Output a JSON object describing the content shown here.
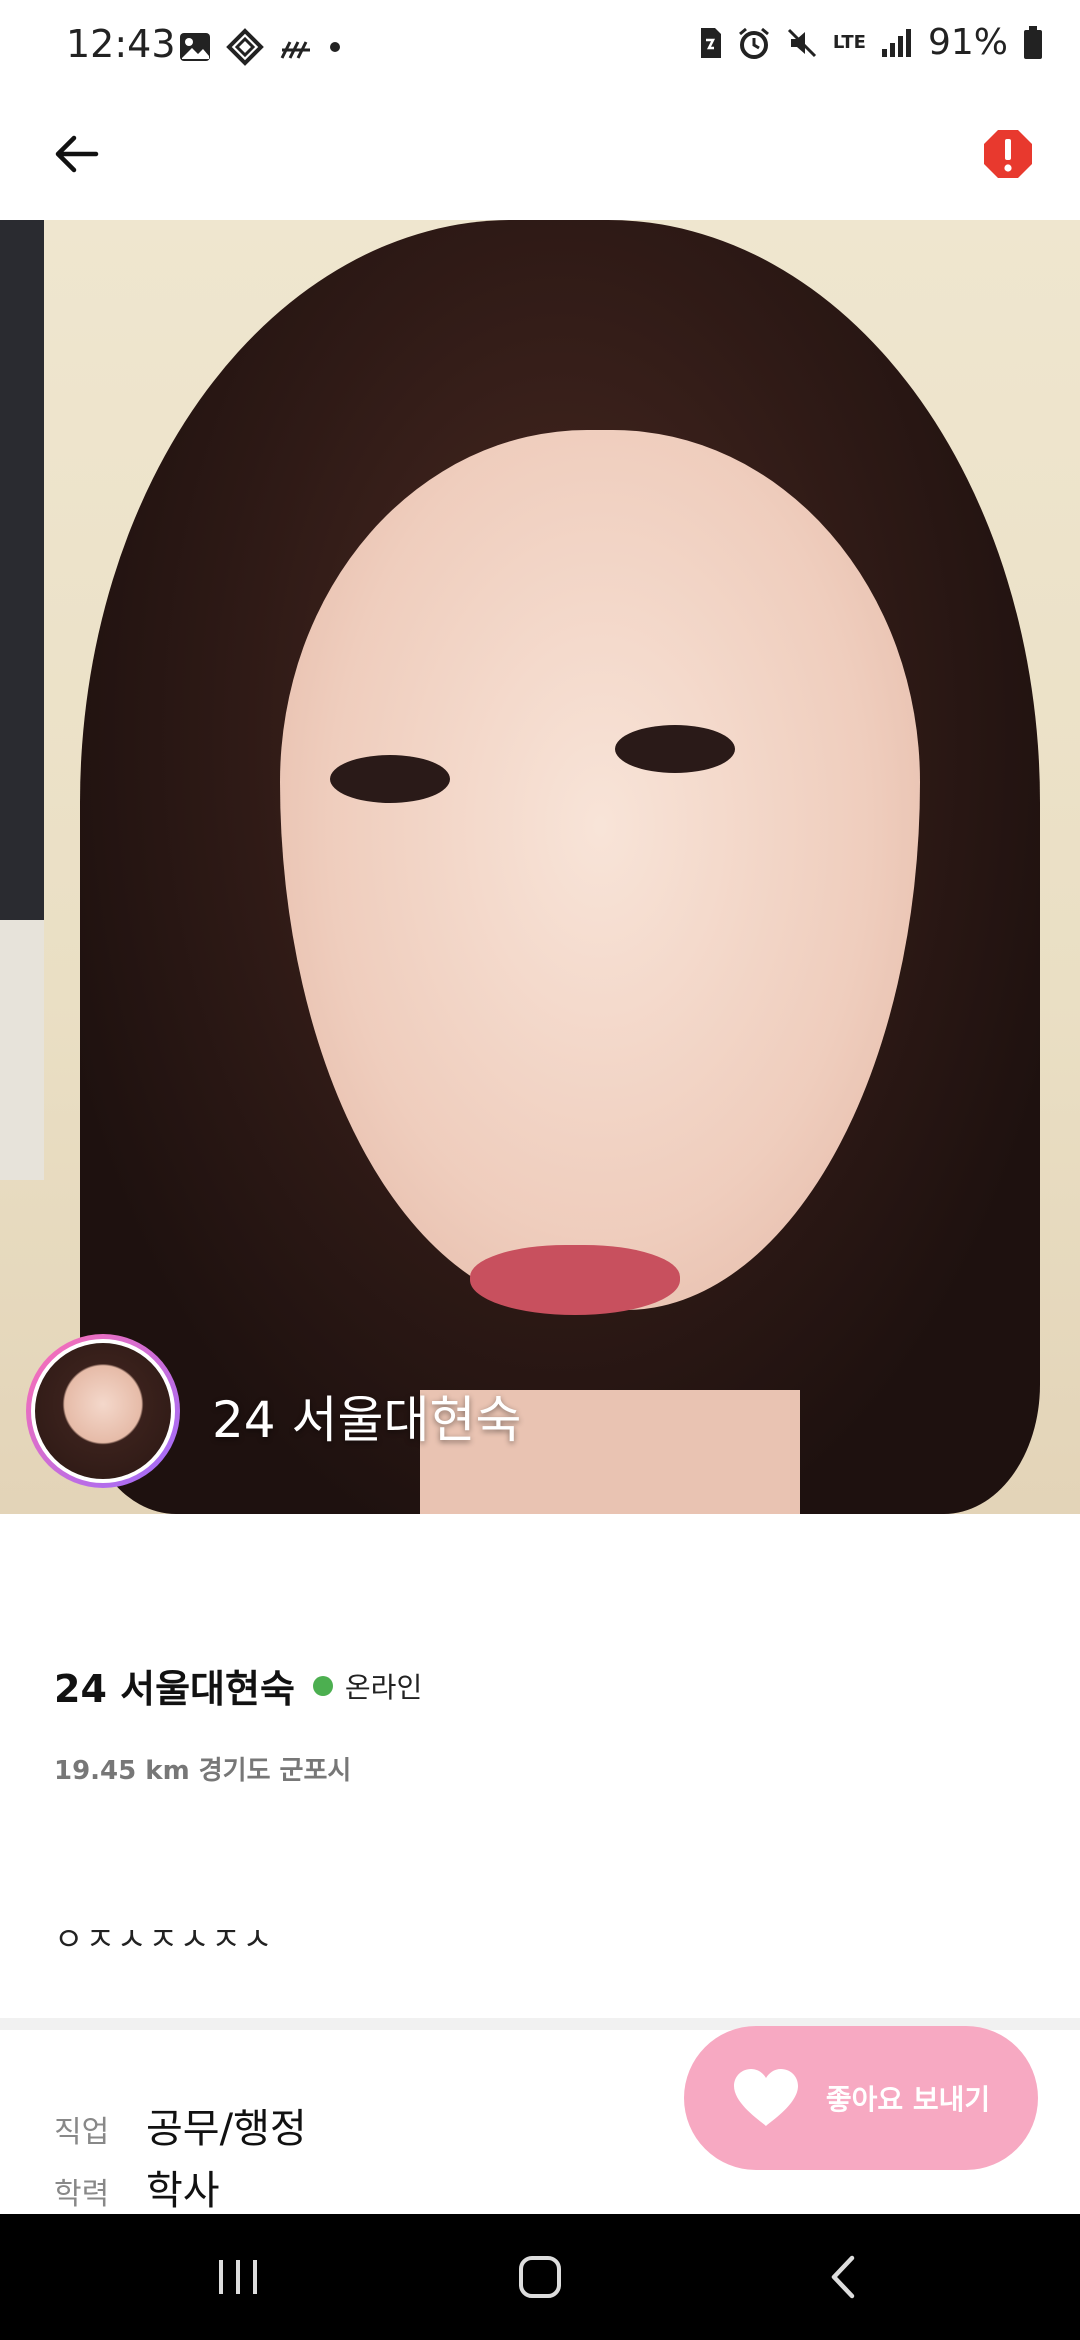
{
  "status_bar": {
    "time": "12:43",
    "battery_percent": "91%",
    "network": "LTE",
    "left_icons": [
      "gallery-icon",
      "app-icon",
      "weather-icon",
      "dot-icon"
    ],
    "right_icons": [
      "sim-icon",
      "alarm-icon",
      "mute-icon",
      "lte-icon",
      "signal-icon",
      "battery-icon"
    ]
  },
  "app_bar": {
    "back_icon": "arrow-left-icon",
    "report_icon": "alert-icon",
    "report_color": "#e8392e"
  },
  "hero": {
    "name_overlay": "24 서울대현숙",
    "avatar_ring_colors": [
      "#ff6fb0",
      "#9a6bff"
    ]
  },
  "profile": {
    "name": "24 서울대현숙",
    "status": "온라인",
    "status_color": "#4caf50",
    "location": "19.45 km 경기도 군포시",
    "bio": "ㅇㅈㅅㅈㅅㅈㅅ"
  },
  "details": [
    {
      "label": "직업",
      "value": "공무/행정"
    },
    {
      "label": "학력",
      "value": "학사"
    }
  ],
  "like_button": {
    "label": "좋아요 보내기",
    "color": "#f7a9c2"
  },
  "nav": {
    "recents_icon": "recents-icon",
    "home_icon": "home-icon",
    "back_icon": "back-icon"
  }
}
